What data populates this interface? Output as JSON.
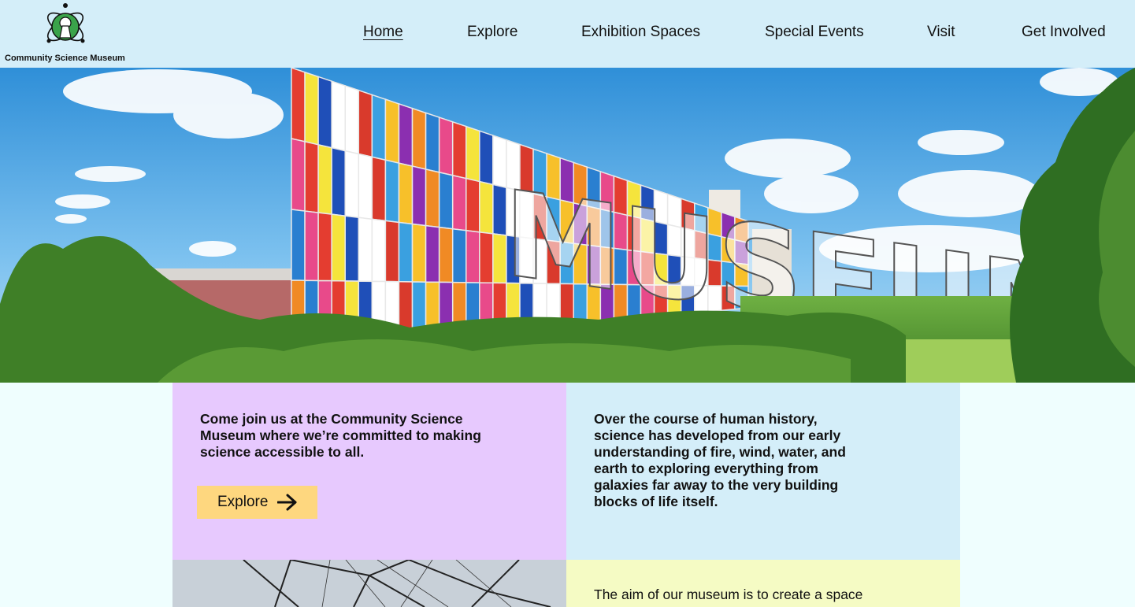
{
  "header": {
    "logo_text": "Community Science Museum",
    "nav": [
      {
        "label": "Home",
        "active": true
      },
      {
        "label": "Explore"
      },
      {
        "label": "Exhibition Spaces"
      },
      {
        "label": "Special Events"
      },
      {
        "label": "Visit"
      },
      {
        "label": "Get Involved"
      }
    ]
  },
  "hero": {
    "image_icon": "museum-building-photo",
    "sign_text": "MUSEUM"
  },
  "intro": {
    "text": "Come join us at the Community Science Museum where we’re committed to making science accessible to all.",
    "button_label": "Explore",
    "button_icon": "arrow-right-icon"
  },
  "history": {
    "text": "Over the course of human history, science has developed from our early understanding of fire, wind, water, and earth to exploring everything from galaxies far away to the very building blocks of life itself."
  },
  "aim": {
    "text": "The aim of our museum is to create a space"
  },
  "colors": {
    "header_bg": "#d4eef9",
    "page_bg": "#effefe",
    "purple_panel": "#e7c9fe",
    "blue_panel": "#d4eef9",
    "yellow_panel": "#f5fbc4",
    "button_bg": "#fed77f",
    "logo_green": "#3aa34a"
  }
}
